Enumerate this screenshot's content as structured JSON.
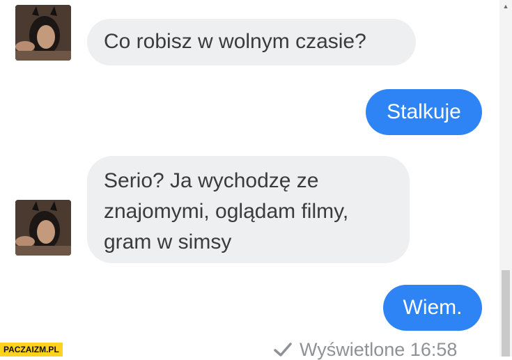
{
  "messages": [
    {
      "direction": "incoming",
      "text": "Co robisz w wolnym czasie?"
    },
    {
      "direction": "outgoing",
      "text": "Stalkuje"
    },
    {
      "direction": "incoming",
      "lines": [
        "Serio? Ja wychodzę ze",
        "znajomymi, oglądam filmy,",
        "gram w simsy"
      ]
    },
    {
      "direction": "outgoing",
      "text": "Wiem."
    }
  ],
  "status": {
    "text": "Wyświetlone 16:58"
  },
  "watermark": "PACZAIZM.PL",
  "colors": {
    "incoming_bubble": "#eeeff1",
    "outgoing_bubble": "#2f84f5",
    "watermark_bg": "#ffd21e"
  }
}
